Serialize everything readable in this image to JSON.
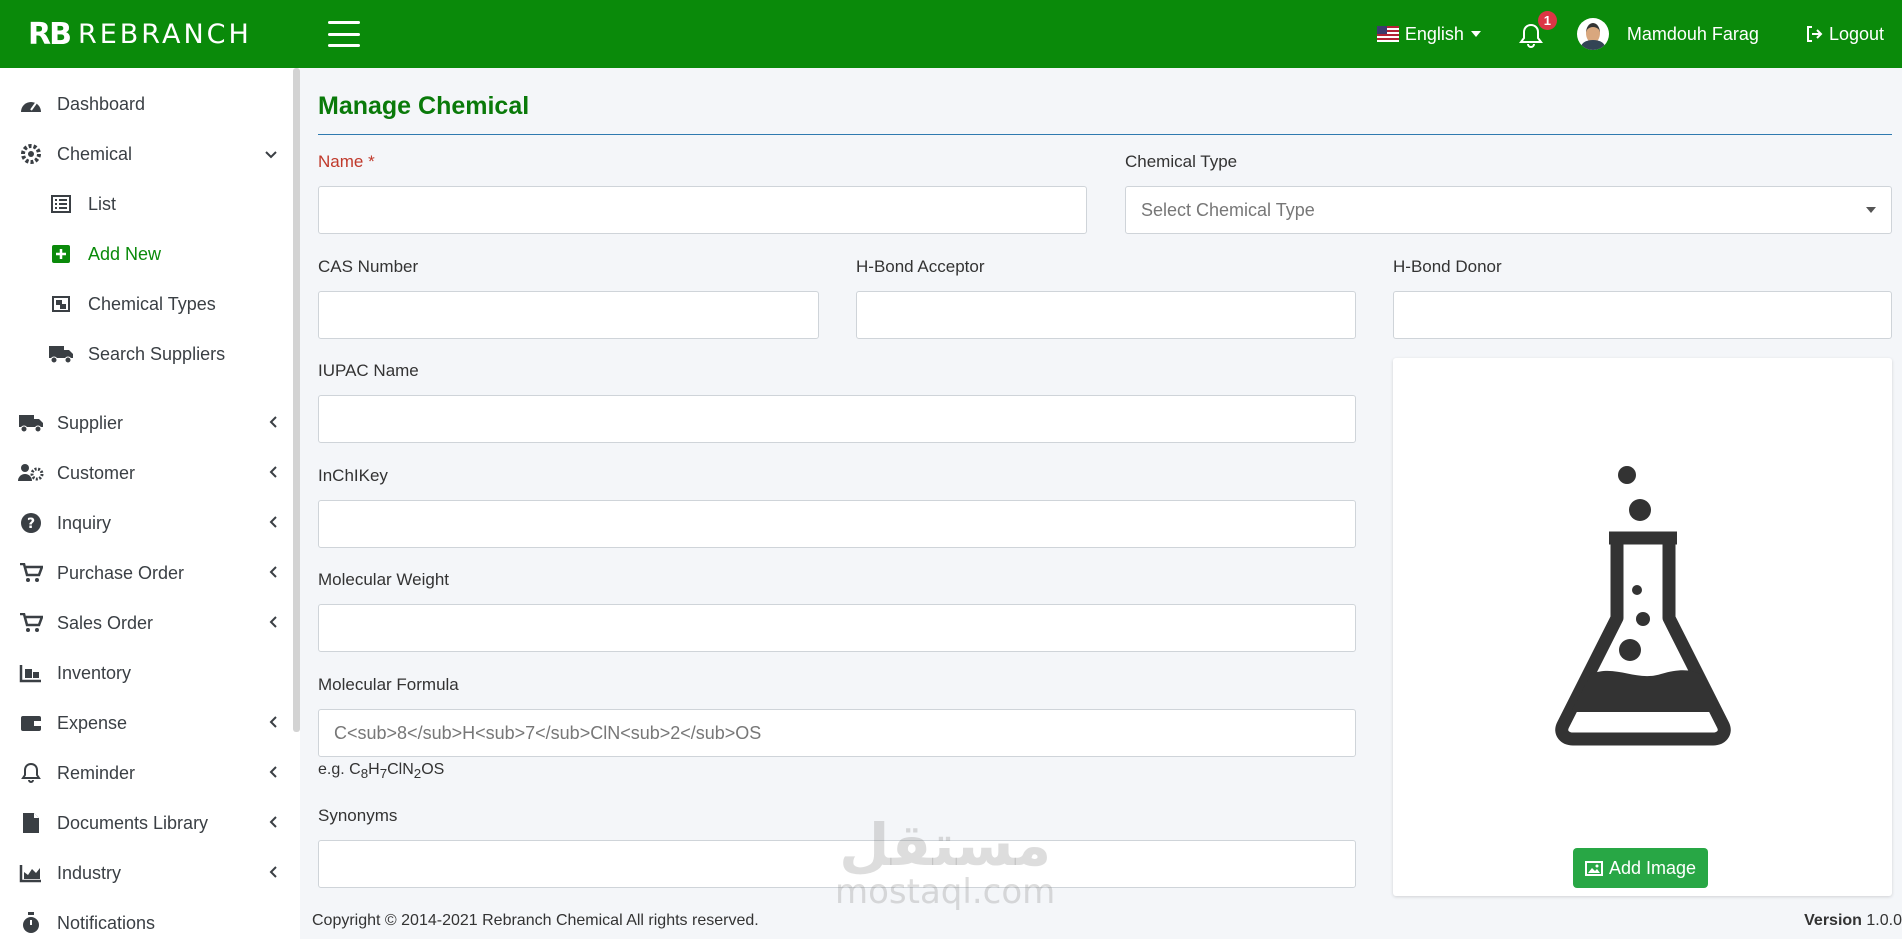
{
  "brand": {
    "mark": "RB",
    "name": "REBRANCH"
  },
  "topbar": {
    "language": "English",
    "notification_count": "1",
    "user_name": "Mamdouh Farag",
    "logout_label": "Logout"
  },
  "sidebar": {
    "dashboard": "Dashboard",
    "chemical": "Chemical",
    "chemical_list": "List",
    "chemical_add": "Add New",
    "chemical_types": "Chemical Types",
    "search_suppliers": "Search Suppliers",
    "supplier": "Supplier",
    "customer": "Customer",
    "inquiry": "Inquiry",
    "purchase_order": "Purchase Order",
    "sales_order": "Sales Order",
    "inventory": "Inventory",
    "expense": "Expense",
    "reminder": "Reminder",
    "documents_library": "Documents Library",
    "industry": "Industry",
    "notifications": "Notifications"
  },
  "form": {
    "title": "Manage Chemical",
    "name_label": "Name",
    "name_required": "*",
    "chemical_type_label": "Chemical Type",
    "chemical_type_placeholder": "Select Chemical Type",
    "cas_label": "CAS Number",
    "hbond_acceptor_label": "H-Bond Acceptor",
    "hbond_donor_label": "H-Bond Donor",
    "iupac_label": "IUPAC Name",
    "inchikey_label": "InChIKey",
    "mw_label": "Molecular Weight",
    "formula_label": "Molecular Formula",
    "formula_placeholder": "C<sub>8</sub>H<sub>7</sub>ClN<sub>2</sub>OS",
    "formula_help_prefix": "e.g. ",
    "formula_help": "C8H7ClN2OS",
    "synonyms_label": "Synonyms",
    "add_image_label": "Add Image"
  },
  "footer": {
    "copyright": "Copyright © 2014-2021 Rebranch Chemical All rights reserved.",
    "version_label": "Version",
    "version_value": "1.0.0"
  },
  "watermark": {
    "arabic": "مستقل",
    "latin": "mostaql.com"
  },
  "colors": {
    "primary": "#0a8a0a",
    "accent_button": "#28a745",
    "badge": "#dc3545"
  }
}
